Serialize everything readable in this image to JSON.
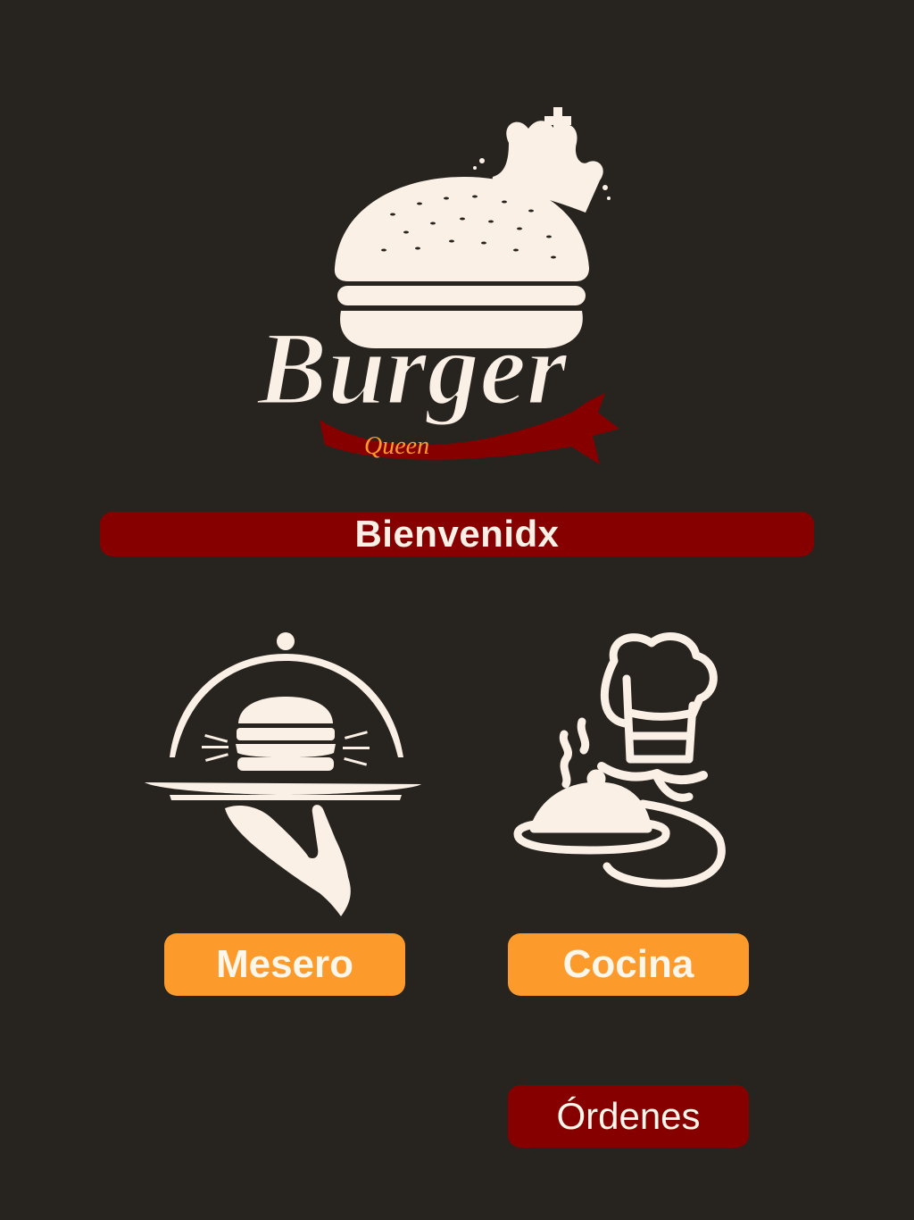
{
  "logo": {
    "icon": "burger-queen-logo",
    "brand_word": "Burger",
    "sub_word": "Queen"
  },
  "welcome": {
    "text": "Bienvenidx"
  },
  "roles": {
    "waiter_icon": "waiter-serving-burger-icon",
    "chef_icon": "chef-with-mustache-icon",
    "mesero_label": "Mesero",
    "cocina_label": "Cocina",
    "ordenes_label": "Órdenes"
  },
  "colors": {
    "background": "#272420",
    "cream": "#fbf0e6",
    "dark_red": "#870000",
    "orange": "#fc9a2c"
  }
}
